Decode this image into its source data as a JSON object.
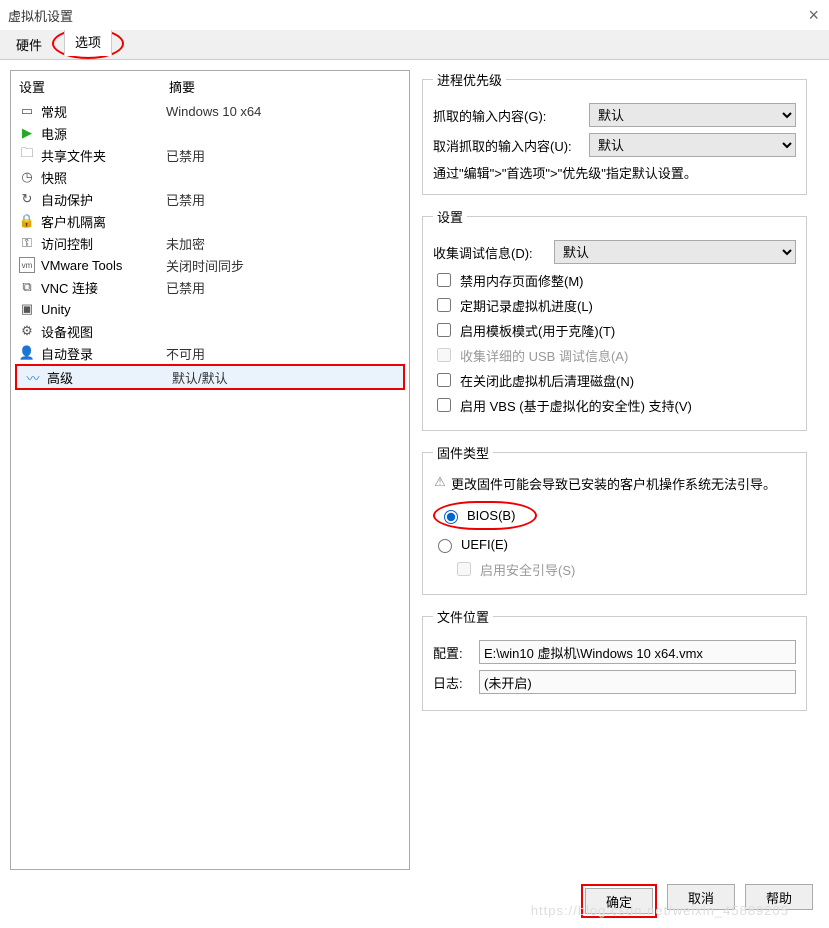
{
  "window": {
    "title": "虚拟机设置"
  },
  "tabs": {
    "hardware": "硬件",
    "options": "选项"
  },
  "left": {
    "headers": {
      "setting": "设置",
      "summary": "摘要"
    },
    "items": [
      {
        "name": "常规",
        "summary": "Windows 10 x64"
      },
      {
        "name": "电源",
        "summary": ""
      },
      {
        "name": "共享文件夹",
        "summary": "已禁用"
      },
      {
        "name": "快照",
        "summary": ""
      },
      {
        "name": "自动保护",
        "summary": "已禁用"
      },
      {
        "name": "客户机隔离",
        "summary": ""
      },
      {
        "name": "访问控制",
        "summary": "未加密"
      },
      {
        "name": "VMware Tools",
        "summary": "关闭时间同步"
      },
      {
        "name": "VNC 连接",
        "summary": "已禁用"
      },
      {
        "name": "Unity",
        "summary": ""
      },
      {
        "name": "设备视图",
        "summary": ""
      },
      {
        "name": "自动登录",
        "summary": "不可用"
      },
      {
        "name": "高级",
        "summary": "默认/默认"
      }
    ]
  },
  "priority": {
    "legend": "进程优先级",
    "grabbed": "抓取的输入内容(G):",
    "ungrabbed": "取消抓取的输入内容(U):",
    "default": "默认",
    "hint": "通过\"编辑\">\"首选项\">\"优先级\"指定默认设置。"
  },
  "settings": {
    "legend": "设置",
    "debug": "收集调试信息(D):",
    "default": "默认",
    "chk_mem": "禁用内存页面修整(M)",
    "chk_log": "定期记录虚拟机进度(L)",
    "chk_tmpl": "启用模板模式(用于克隆)(T)",
    "chk_usb": "收集详细的 USB 调试信息(A)",
    "chk_clean": "在关闭此虚拟机后清理磁盘(N)",
    "chk_vbs": "启用 VBS (基于虚拟化的安全性) 支持(V)"
  },
  "firmware": {
    "legend": "固件类型",
    "warn": "更改固件可能会导致已安装的客户机操作系统无法引导。",
    "bios": "BIOS(B)",
    "uefi": "UEFI(E)",
    "secure": "启用安全引导(S)"
  },
  "fileloc": {
    "legend": "文件位置",
    "config": "配置:",
    "config_val": "E:\\win10 虚拟机\\Windows 10 x64.vmx",
    "log": "日志:",
    "log_val": "(未开启)"
  },
  "buttons": {
    "ok": "确定",
    "cancel": "取消",
    "help": "帮助"
  },
  "watermark": "https://blog.csdn.net/weixin_45889205"
}
